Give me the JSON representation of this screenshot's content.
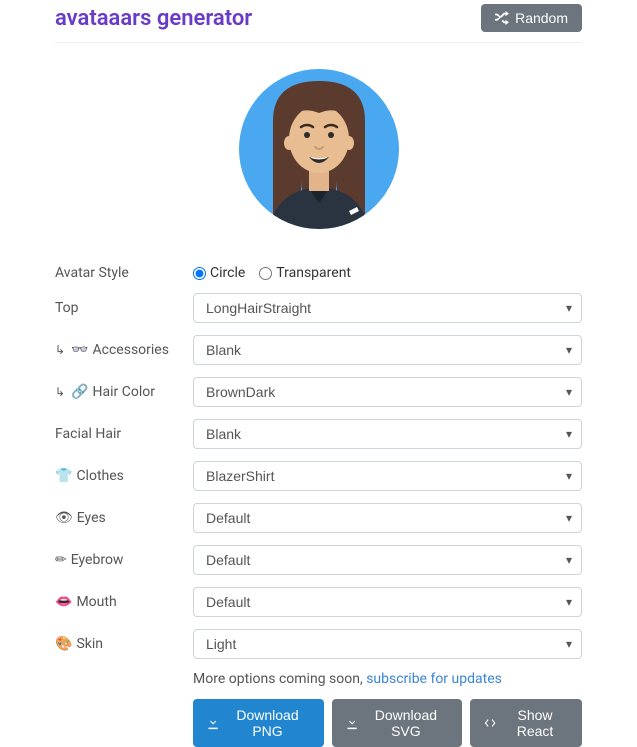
{
  "header": {
    "title": "avataaars generator",
    "random_btn": "Random"
  },
  "form": {
    "avatar_style": {
      "label": "Avatar Style",
      "options": {
        "circle": "Circle",
        "transparent": "Transparent"
      },
      "selected": "circle"
    },
    "fields": [
      {
        "key": "top",
        "label": "Top",
        "icon": "",
        "pre": "",
        "value": "LongHairStraight"
      },
      {
        "key": "accessories",
        "label": "Accessories",
        "icon": "👓",
        "pre": "↳",
        "value": "Blank"
      },
      {
        "key": "hair_color",
        "label": "Hair Color",
        "icon": "🔗",
        "pre": "↳",
        "value": "BrownDark"
      },
      {
        "key": "facial_hair",
        "label": "Facial Hair",
        "icon": "",
        "pre": "",
        "value": "Blank"
      },
      {
        "key": "clothes",
        "label": "Clothes",
        "icon": "👕",
        "pre": "",
        "value": "BlazerShirt"
      },
      {
        "key": "eyes",
        "label": "Eyes",
        "icon": "👁",
        "pre": "",
        "value": "Default"
      },
      {
        "key": "eyebrow",
        "label": "Eyebrow",
        "icon": "✏",
        "pre": "",
        "value": "Default"
      },
      {
        "key": "mouth",
        "label": "Mouth",
        "icon": "👄",
        "pre": "",
        "value": "Default"
      },
      {
        "key": "skin",
        "label": "Skin",
        "icon": "🎨",
        "pre": "",
        "value": "Light"
      }
    ]
  },
  "footer": {
    "more_text": "More options coming soon, ",
    "subscribe_label": "subscribe for updates",
    "buttons": {
      "png": "Download PNG",
      "svg": "Download SVG",
      "react": "Show React"
    }
  }
}
